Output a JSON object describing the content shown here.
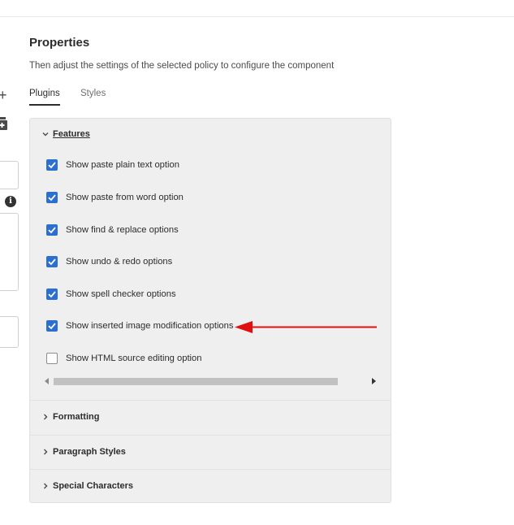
{
  "header": {
    "title": "Properties",
    "description": "Then adjust the settings of the selected policy to configure the component"
  },
  "tabs": [
    {
      "label": "Plugins",
      "active": true
    },
    {
      "label": "Styles",
      "active": false
    }
  ],
  "left_column": {
    "info_glyph": "i"
  },
  "accordion": {
    "features": {
      "label": "Features",
      "expanded": true,
      "options": [
        {
          "label": "Show paste plain text option",
          "checked": true
        },
        {
          "label": "Show paste from word option",
          "checked": true
        },
        {
          "label": "Show find & replace options",
          "checked": true
        },
        {
          "label": "Show undo & redo options",
          "checked": true
        },
        {
          "label": "Show spell checker options",
          "checked": true
        },
        {
          "label": "Show inserted image modification options",
          "checked": true
        },
        {
          "label": "Show HTML source editing option",
          "checked": false
        }
      ]
    },
    "sections": [
      {
        "label": "Formatting",
        "expanded": false
      },
      {
        "label": "Paragraph Styles",
        "expanded": false
      },
      {
        "label": "Special Characters",
        "expanded": false
      }
    ]
  },
  "colors": {
    "checkbox_checked": "#2b6fd0",
    "annotation_arrow": "#e01010"
  }
}
